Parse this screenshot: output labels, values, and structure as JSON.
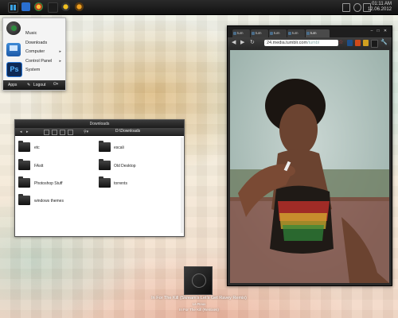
{
  "taskbar": {
    "clock_time": "01:11 AM",
    "clock_date": "12.06.2012"
  },
  "start_menu": {
    "items": [
      {
        "label": "Music",
        "icon": "music-icon"
      },
      {
        "label": "Downloads",
        "icon": "downloads-icon"
      },
      {
        "label": "Computer",
        "has_submenu": true
      },
      {
        "label": "Control Panel",
        "has_submenu": true
      },
      {
        "label": "System",
        "icon": "photoshop-icon",
        "icon_text": "Ps"
      }
    ],
    "footer": {
      "apps_label": "Apps",
      "logout_label": "Logout"
    }
  },
  "downloads_window": {
    "title": "Downloads",
    "path": "D:\\Downloads",
    "items": [
      {
        "name": "etc"
      },
      {
        "name": "escali"
      },
      {
        "name": "FAstt"
      },
      {
        "name": "Old Desktop"
      },
      {
        "name": "Photoshop Stuff"
      },
      {
        "name": "torrents"
      },
      {
        "name": "windows themes"
      }
    ]
  },
  "browser": {
    "tab_labels": [
      "tum",
      "tum",
      "tum",
      "tum",
      "tum"
    ],
    "active_tab": 4,
    "url_host": "24.media.tumblr.com",
    "url_path": "/tumbl"
  },
  "music": {
    "title": "In For The Kill (Skream's Let's Get Ravey Remix)",
    "artist": "La Roux",
    "album": "In For The Kill (Remixes)"
  },
  "colors": {
    "accent": "#2a6fd0",
    "taskbar": "#1a1a1a"
  }
}
